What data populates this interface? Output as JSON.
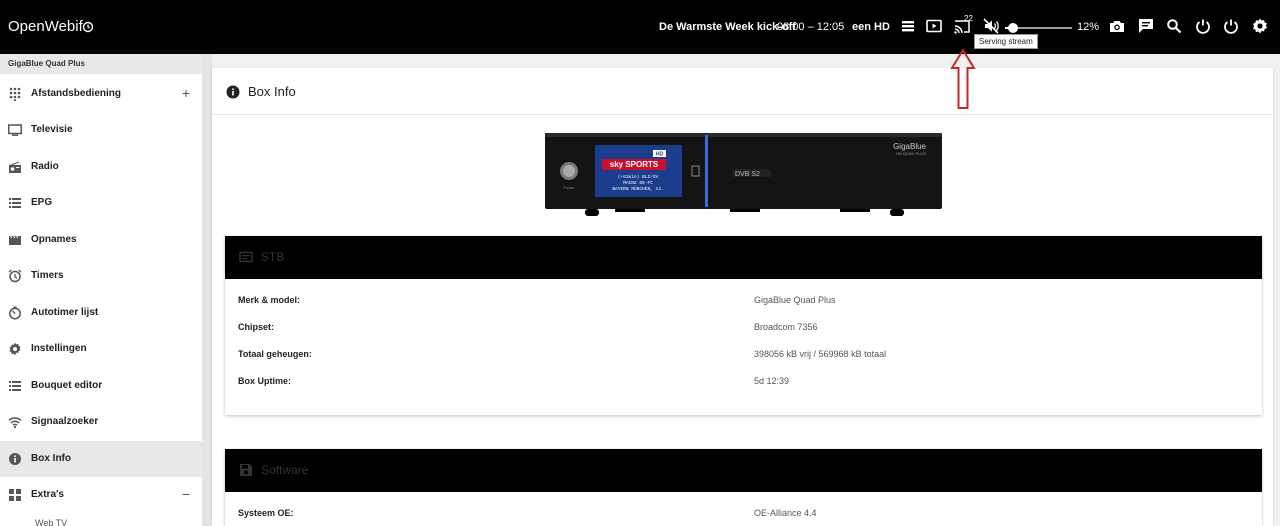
{
  "topbar": {
    "brand": "OpenWebif",
    "now_playing": "De Warmste Week kick-off",
    "time_range": "08:00 – 12:05",
    "channel": "een HD",
    "stream_count": "22",
    "volume_percent": 12,
    "volume_label": "12%",
    "tooltip": "Serving stream",
    "icons": [
      "clock-icon",
      "channel-list-icon",
      "tv-icon",
      "cast-icon",
      "mute-icon",
      "camera-icon",
      "message-icon",
      "search-icon",
      "power-icon",
      "standby-icon",
      "settings-icon"
    ]
  },
  "sidebar": {
    "device": "GigaBlue Quad Plus",
    "items": [
      {
        "label": "Afstandsbediening",
        "toggle": "+"
      },
      {
        "label": "Televisie"
      },
      {
        "label": "Radio"
      },
      {
        "label": "EPG"
      },
      {
        "label": "Opnames"
      },
      {
        "label": "Timers"
      },
      {
        "label": "Autotimer lijst"
      },
      {
        "label": "Instellingen"
      },
      {
        "label": "Bouquet editor"
      },
      {
        "label": "Signaalzoeker"
      },
      {
        "label": "Box Info"
      },
      {
        "label": "Extra's",
        "toggle": "−"
      }
    ],
    "subitem": "Web TV"
  },
  "main": {
    "title": "Box Info",
    "stb": {
      "title": "STB",
      "rows": [
        {
          "label": "Merk & model:",
          "value": "GigaBlue Quad Plus"
        },
        {
          "label": "Chipset:",
          "value": "Broadcom 7356"
        },
        {
          "label": "Totaal geheugen:",
          "value": "398056 kB vrij / 569968 kB totaal"
        },
        {
          "label": "Box Uptime:",
          "value": "5d 12:39"
        }
      ]
    },
    "software": {
      "title": "Software",
      "rows": [
        {
          "label": "Systeem OE:",
          "value": "OE-Alliance 4.4"
        }
      ]
    },
    "device_image": {
      "brand": "GigaBlue",
      "model": "HD QUAD PLUS",
      "screen_logo": "sky SPORTS",
      "screen_badge": "HD",
      "screen_lines": [
        "(+62min) BLI/SV",
        "MAINZ 05-FC",
        "BAYERN MÜNCHEN, 14."
      ],
      "power_label": "Power"
    },
    "colors": {
      "accent_annotation": "#c62828",
      "header_bg": "#000000"
    }
  }
}
